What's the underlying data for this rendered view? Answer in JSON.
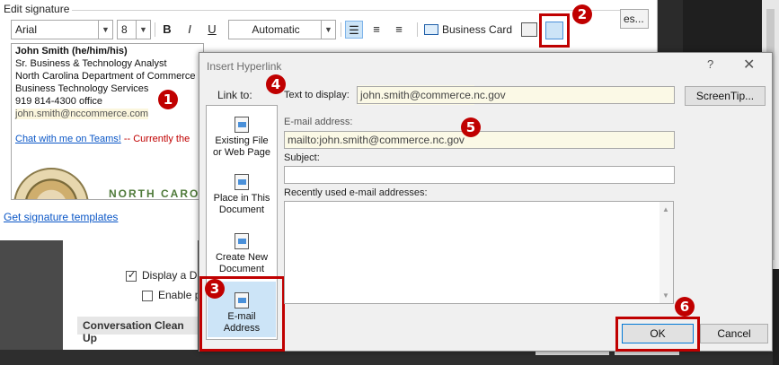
{
  "signature_window": {
    "legend": "Edit signature",
    "font_name": "Arial",
    "font_size": "8",
    "color": "Automatic",
    "bold": "B",
    "italic": "I",
    "underline": "U",
    "business_card": "Business Card",
    "top_right_button": "es...",
    "lines": [
      "John Smith (he/him/his)",
      "Sr. Business & Technology Analyst",
      "North Carolina Department of Commerce",
      "Business Technology Services",
      "919 814-4300 office",
      "john.smith@nccommerce.com"
    ],
    "teams_link": "Chat with me on Teams!",
    "teams_status": " -- Currently the",
    "logo_text": "NORTH CAROL",
    "templates_link": "Get signature templates"
  },
  "background_options": {
    "option1": "Display a De",
    "option2": "Enable p",
    "section": "Conversation Clean Up"
  },
  "dialog": {
    "title": "Insert Hyperlink",
    "help": "?",
    "close": "✕",
    "link_to": "Link to:",
    "link_items": [
      {
        "label1": "Existing File",
        "label2": "or Web Page"
      },
      {
        "label1": "Place in This",
        "label2": "Document"
      },
      {
        "label1": "Create New",
        "label2": "Document"
      },
      {
        "label1": "E-mail",
        "label2": "Address"
      }
    ],
    "text_to_display_label": "Text to display:",
    "text_to_display_value": "john.smith@commerce.nc.gov",
    "screentip": "ScreenTip...",
    "email_label": "E-mail address:",
    "email_value": "mailto:john.smith@commerce.nc.gov",
    "subject_label": "Subject:",
    "subject_value": "",
    "recent_label": "Recently used e-mail addresses:",
    "ok": "OK",
    "cancel": "Cancel"
  },
  "callouts": [
    "1",
    "2",
    "3",
    "4",
    "5",
    "6"
  ],
  "colors": {
    "callout": "#c00000",
    "highlight": "#cce4f7",
    "link": "#0b57c7"
  }
}
